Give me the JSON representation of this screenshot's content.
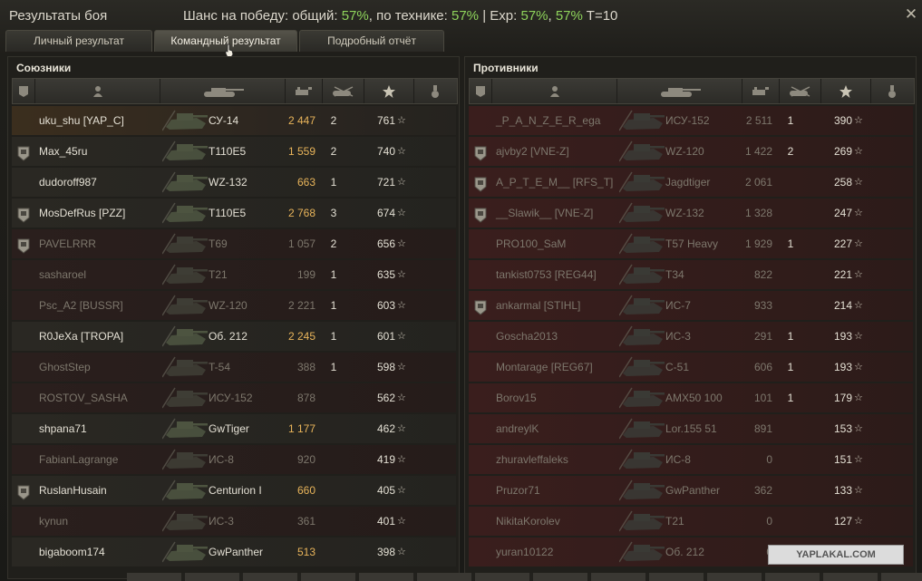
{
  "title": "Результаты боя",
  "chance": {
    "label": "Шанс на победу: общий:",
    "total": "57%",
    "sep1": ", по технике:",
    "tech": "57%",
    "sep2": " | Exp:",
    "exp1": "57%",
    "sep3": ",",
    "exp2": "57%",
    "tier": " T=10"
  },
  "close_glyph": "✕",
  "tabs": [
    {
      "label": "Личный результат",
      "active": false
    },
    {
      "label": "Командный результат",
      "active": true
    },
    {
      "label": "Подробный отчёт",
      "active": false
    }
  ],
  "allies": {
    "title": "Союзники",
    "rows": [
      {
        "name": "uku_shu [YAP_C]",
        "tank": "СУ-14",
        "damage": "2 447",
        "kills": "2",
        "exp": "761",
        "badge": false,
        "dead": false,
        "me": true
      },
      {
        "name": "Max_45ru",
        "tank": "T110E5",
        "damage": "1 559",
        "kills": "2",
        "exp": "740",
        "badge": true,
        "dead": false
      },
      {
        "name": "dudoroff987",
        "tank": "WZ-132",
        "damage": "663",
        "kills": "1",
        "exp": "721",
        "badge": false,
        "dead": false
      },
      {
        "name": "MosDefRus [PZZ]",
        "tank": "T110E5",
        "damage": "2 768",
        "kills": "3",
        "exp": "674",
        "badge": true,
        "dead": false
      },
      {
        "name": "PAVELRRR",
        "tank": "T69",
        "damage": "1 057",
        "kills": "2",
        "exp": "656",
        "badge": true,
        "dead": true
      },
      {
        "name": "sasharoel",
        "tank": "T21",
        "damage": "199",
        "kills": "1",
        "exp": "635",
        "badge": false,
        "dead": true
      },
      {
        "name": "Psc_A2 [BUSSR]",
        "tank": "WZ-120",
        "damage": "2 221",
        "kills": "1",
        "exp": "603",
        "badge": false,
        "dead": true
      },
      {
        "name": "R0JeXa [TROPA]",
        "tank": "Об. 212",
        "damage": "2 245",
        "kills": "1",
        "exp": "601",
        "badge": false,
        "dead": false
      },
      {
        "name": "GhostStep",
        "tank": "T-54",
        "damage": "388",
        "kills": "1",
        "exp": "598",
        "badge": false,
        "dead": true
      },
      {
        "name": "ROSTOV_SASHA",
        "tank": "ИСУ-152",
        "damage": "878",
        "kills": "",
        "exp": "562",
        "badge": false,
        "dead": true
      },
      {
        "name": "shpana71",
        "tank": "GwTiger",
        "damage": "1 177",
        "kills": "",
        "exp": "462",
        "badge": false,
        "dead": false
      },
      {
        "name": "FabianLagrange",
        "tank": "ИС-8",
        "damage": "920",
        "kills": "",
        "exp": "419",
        "badge": false,
        "dead": true
      },
      {
        "name": "RuslanHusain",
        "tank": "Centurion I",
        "damage": "660",
        "kills": "",
        "exp": "405",
        "badge": true,
        "dead": false
      },
      {
        "name": "kynun",
        "tank": "ИС-3",
        "damage": "361",
        "kills": "",
        "exp": "401",
        "badge": false,
        "dead": true
      },
      {
        "name": "bigaboom174",
        "tank": "GwPanther",
        "damage": "513",
        "kills": "",
        "exp": "398",
        "badge": false,
        "dead": false
      }
    ]
  },
  "enemies": {
    "title": "Противники",
    "rows": [
      {
        "name": "_P_A_N_Z_E_R_ega",
        "tank": "ИСУ-152",
        "damage": "2 511",
        "kills": "1",
        "exp": "390",
        "badge": false,
        "alive": false
      },
      {
        "name": "ajvby2 [VNE-Z]",
        "tank": "WZ-120",
        "damage": "1 422",
        "kills": "2",
        "exp": "269",
        "badge": true,
        "alive": false
      },
      {
        "name": "A_P_T_E_M__ [RFS_T]",
        "tank": "Jagdtiger",
        "damage": "2 061",
        "kills": "",
        "exp": "258",
        "badge": true,
        "alive": false
      },
      {
        "name": "__Slawik__ [VNE-Z]",
        "tank": "WZ-132",
        "damage": "1 328",
        "kills": "",
        "exp": "247",
        "badge": true,
        "alive": false
      },
      {
        "name": "PRO100_SaM",
        "tank": "T57 Heavy",
        "damage": "1 929",
        "kills": "1",
        "exp": "227",
        "badge": false,
        "alive": false
      },
      {
        "name": "tankist0753 [REG44]",
        "tank": "T34",
        "damage": "822",
        "kills": "",
        "exp": "221",
        "badge": false,
        "alive": false
      },
      {
        "name": "ankarmal [STIHL]",
        "tank": "ИС-7",
        "damage": "933",
        "kills": "",
        "exp": "214",
        "badge": true,
        "alive": false
      },
      {
        "name": "Goscha2013",
        "tank": "ИС-3",
        "damage": "291",
        "kills": "1",
        "exp": "193",
        "badge": false,
        "alive": false
      },
      {
        "name": "Montarage [REG67]",
        "tank": "С-51",
        "damage": "606",
        "kills": "1",
        "exp": "193",
        "badge": false,
        "alive": false
      },
      {
        "name": "Borov15",
        "tank": "AMX50 100",
        "damage": "101",
        "kills": "1",
        "exp": "179",
        "badge": false,
        "alive": false
      },
      {
        "name": "andreylK",
        "tank": "Lor.155 51",
        "damage": "891",
        "kills": "",
        "exp": "153",
        "badge": false,
        "alive": false
      },
      {
        "name": "zhuravleffaleks",
        "tank": "ИС-8",
        "damage": "0",
        "kills": "",
        "exp": "151",
        "badge": false,
        "alive": false
      },
      {
        "name": "Pruzor71",
        "tank": "GwPanther",
        "damage": "362",
        "kills": "",
        "exp": "133",
        "badge": false,
        "alive": false
      },
      {
        "name": "NikitaKorolev",
        "tank": "T21",
        "damage": "0",
        "kills": "",
        "exp": "127",
        "badge": false,
        "alive": false
      },
      {
        "name": "yuran10122",
        "tank": "Об. 212",
        "damage": "0",
        "kills": "",
        "exp": "100",
        "badge": false,
        "alive": false
      }
    ]
  },
  "icons": {
    "header_platoon": "platoon-icon",
    "header_player": "player-icon",
    "header_tank": "tank-icon",
    "header_damage": "damage-icon",
    "header_kills": "kills-icon",
    "header_exp": "star-icon",
    "header_medal": "medal-icon",
    "row_exp": "star-icon"
  },
  "star_glyph": "☆",
  "watermark": "YAPLAKAL.COM"
}
